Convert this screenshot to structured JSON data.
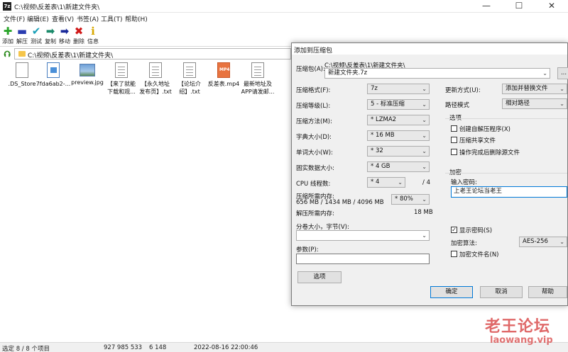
{
  "window": {
    "title": "C:\\视频\\反差表\\1\\新建文件夹\\",
    "app_icon_label": "7z",
    "minimize": "—",
    "maximize": "☐",
    "close": "✕"
  },
  "menu": [
    "文件(F)",
    "编辑(E)",
    "查看(V)",
    "书签(A)",
    "工具(T)",
    "帮助(H)"
  ],
  "toolbar": [
    {
      "label": "添加",
      "icon": "plus-icon",
      "glyph": "✚",
      "color": "#2aa52a"
    },
    {
      "label": "解压",
      "icon": "minus-icon",
      "glyph": "▬",
      "color": "#2a3cb0"
    },
    {
      "label": "测试",
      "icon": "check-icon",
      "glyph": "✔",
      "color": "#1aa0b8"
    },
    {
      "label": "复制",
      "icon": "copy-arrow-icon",
      "glyph": "➡",
      "color": "#1a8a6a"
    },
    {
      "label": "移动",
      "icon": "move-arrow-icon",
      "glyph": "➡",
      "color": "#1a2a9a"
    },
    {
      "label": "删除",
      "icon": "delete-icon",
      "glyph": "✖",
      "color": "#d01818"
    },
    {
      "label": "信息",
      "icon": "info-icon",
      "glyph": "ℹ",
      "color": "#d8a800"
    }
  ],
  "address": "C:\\视频\\反差表\\1\\新建文件夹\\",
  "files": [
    {
      "name": ".DS_Store",
      "type": "doc"
    },
    {
      "name": "7fda6ab2-...",
      "type": "png"
    },
    {
      "name": "preview.jpg",
      "type": "img"
    },
    {
      "name": "【来了就能\n下载和观...",
      "type": "txt"
    },
    {
      "name": "【永久地址\n发布页】.txt",
      "type": "txt"
    },
    {
      "name": "【论坛介\n绍】.txt",
      "type": "txt"
    },
    {
      "name": "反差表.mp4",
      "type": "mp4"
    },
    {
      "name": "最新地址及\nAPP请发邮...",
      "type": "txt"
    }
  ],
  "status": {
    "selection": "选定 8 / 8 个项目",
    "size": "927 985 533",
    "packed": "6 148",
    "modified": "2022-08-16 22:00:46"
  },
  "dialog": {
    "title": "添加到压缩包",
    "archive_label": "压缩包(A):",
    "archive_path": "C:\\视频\\反差表\\1\\新建文件夹\\",
    "archive_name": "新建文件夹.7z",
    "browse_label": "...",
    "format_label": "压缩格式(F):",
    "format_value": "7z",
    "level_label": "压缩等级(L):",
    "level_value": "5 - 标准压缩",
    "method_label": "压缩方法(M):",
    "method_value": "* LZMA2",
    "dict_label": "字典大小(D):",
    "dict_value": "* 16 MB",
    "word_label": "单词大小(W):",
    "word_value": "* 32",
    "solid_label": "固实数据大小:",
    "solid_value": "* 4 GB",
    "threads_label": "CPU 线程数:",
    "threads_value": "* 4",
    "threads_max": "/ 4",
    "mem_comp_label": "压缩所需内存:",
    "mem_comp_value": "656 MB / 1434 MB / 4096 MB",
    "mem_pct_value": "* 80%",
    "mem_decomp_label": "解压所需内存:",
    "mem_decomp_value": "18 MB",
    "split_label": "分卷大小，字节(V):",
    "split_value": "",
    "params_label": "参数(P):",
    "params_value": "",
    "options_button": "选项",
    "update_label": "更新方式(U):",
    "update_value": "添加并替换文件",
    "path_label": "路径模式",
    "path_value": "相对路径",
    "options_group": "选项",
    "opt_sfx": "创建自解压程序(X)",
    "opt_shared": "压缩共享文件",
    "opt_delete": "操作完成后删除源文件",
    "enc_group": "加密",
    "enc_password_label": "输入密码:",
    "enc_password_value": "上老王论坛当老王",
    "show_password": "显示密码(S)",
    "enc_method_label": "加密算法:",
    "enc_method_value": "AES-256",
    "enc_filenames": "加密文件名(N)",
    "ok": "确定",
    "cancel": "取消",
    "help": "帮助"
  },
  "watermark": {
    "line1": "老王论坛",
    "line2": "laowang.vip"
  }
}
